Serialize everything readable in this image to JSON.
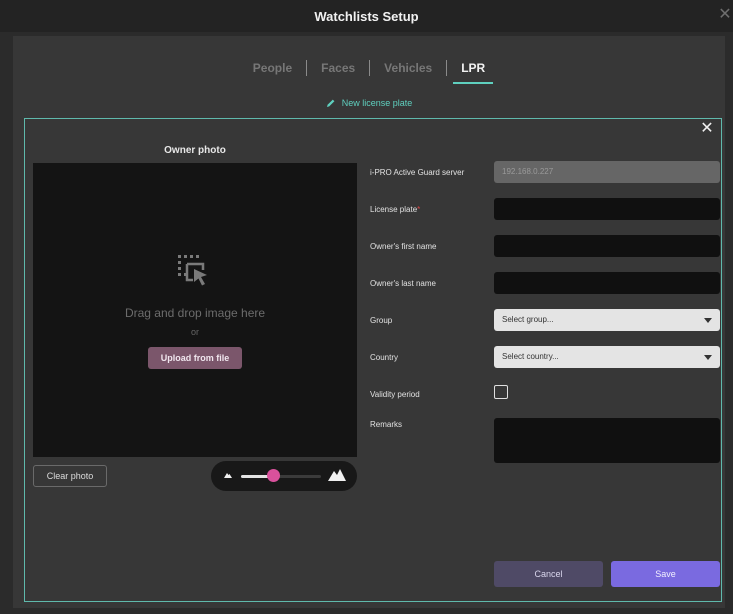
{
  "window": {
    "title": "Watchlists Setup",
    "close_icon": "close-icon"
  },
  "tabs": [
    {
      "label": "People"
    },
    {
      "label": "Faces"
    },
    {
      "label": "Vehicles"
    },
    {
      "label": "LPR",
      "active": true
    }
  ],
  "subheader": {
    "label": "New license plate",
    "icon": "pencil-icon"
  },
  "photo": {
    "title": "Owner photo",
    "drop_text": "Drag and drop image here",
    "or_text": "or",
    "upload_label": "Upload from file",
    "clear_label": "Clear photo",
    "zoom_level": 0.4
  },
  "form": {
    "server_label": "i-PRO Active Guard server",
    "server_value": "192.168.0.227",
    "plate_label": "License plate",
    "plate_required": "*",
    "first_name_label": "Owner's first name",
    "last_name_label": "Owner's last name",
    "group_label": "Group",
    "group_placeholder": "Select group...",
    "country_label": "Country",
    "country_placeholder": "Select country...",
    "validity_label": "Validity period",
    "remarks_label": "Remarks"
  },
  "actions": {
    "cancel_label": "Cancel",
    "save_label": "Save"
  },
  "colors": {
    "accent": "#5fd0bf",
    "save": "#7a6ae0",
    "cancel": "#4f4a66",
    "upload": "#7b566b",
    "slider_thumb": "#d9519c"
  }
}
